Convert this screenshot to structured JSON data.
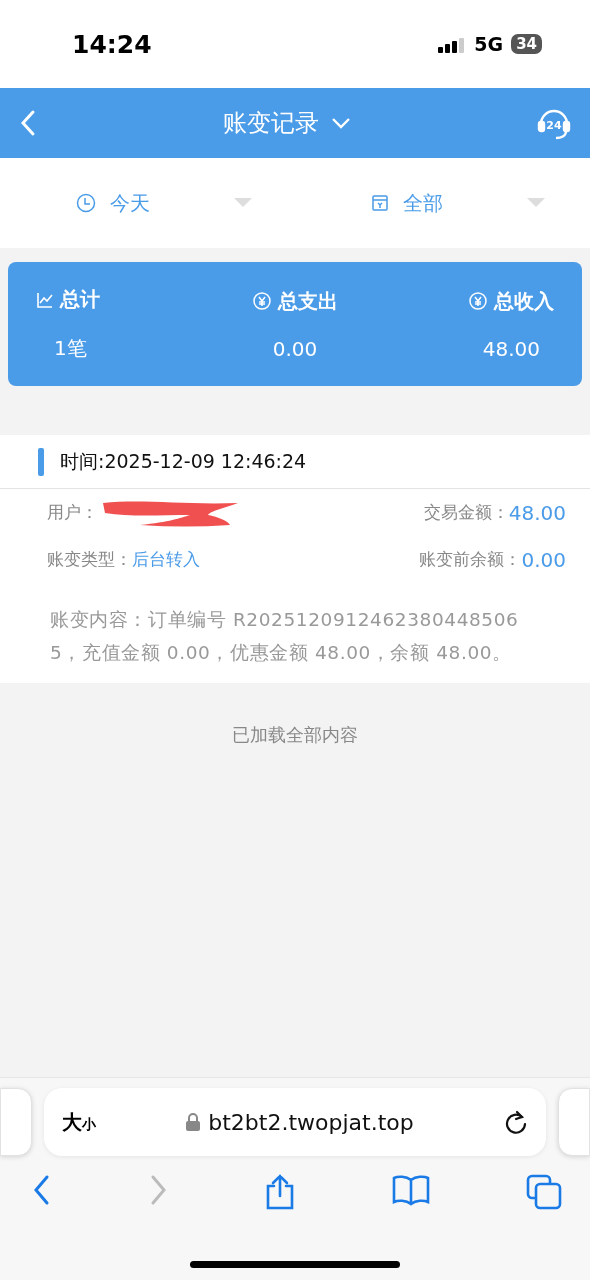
{
  "status_bar": {
    "time": "14:24",
    "network": "5G",
    "battery": "34"
  },
  "header": {
    "title": "账变记录",
    "support_badge": "24"
  },
  "filters": [
    {
      "kind": "time",
      "label": "今天"
    },
    {
      "kind": "type",
      "label": "全部"
    }
  ],
  "summary": [
    {
      "kind": "chart",
      "label": "总计",
      "value": "1笔"
    },
    {
      "kind": "money",
      "label": "总支出",
      "value": "0.00"
    },
    {
      "kind": "money",
      "label": "总收入",
      "value": "48.00"
    }
  ],
  "record": {
    "time": "时间:2025-12-09 12:46:24",
    "user": {
      "label": "用户：",
      "redacted": true
    },
    "amount": {
      "label": "交易金额：",
      "value": "48.00"
    },
    "type": {
      "label": "账变类型：",
      "value": "后台转入"
    },
    "before": {
      "label": "账变前余额：",
      "value": "0.00"
    },
    "content": "账变内容：订单编号 R20251209124623804485065，充值金额 0.00，优惠金额 48.00，余额 48.00。"
  },
  "footer_note": "已加载全部内容",
  "browser": {
    "text_size_big": "大",
    "text_size_small": "小",
    "url": "bt2bt2.twopjat.top",
    "forward_disabled": true
  }
}
